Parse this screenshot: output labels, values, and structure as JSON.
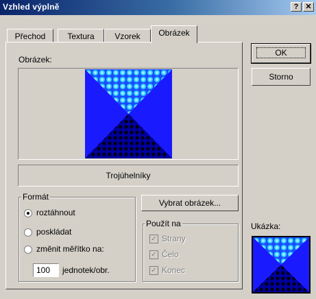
{
  "window": {
    "title": "Vzhled výplně"
  },
  "titlebar": {
    "help_glyph": "?",
    "close_glyph": "✕"
  },
  "tabs": [
    {
      "label": "Přechod"
    },
    {
      "label": "Textura"
    },
    {
      "label": "Vzorek"
    },
    {
      "label": "Obrázek",
      "active": true
    }
  ],
  "picture": {
    "label": "Obrázek:",
    "name": "Trojúhelníky"
  },
  "format": {
    "label": "Formát",
    "options": [
      {
        "label": "roztáhnout",
        "selected": true
      },
      {
        "label": "poskládat",
        "selected": false
      },
      {
        "label": "změnit měřítko na:",
        "selected": false
      }
    ],
    "scale_value": "100",
    "scale_unit": "jednotek/obr."
  },
  "select_picture_button": "Vybrat obrázek...",
  "apply_to": {
    "label": "Použít na",
    "items": [
      {
        "label": "Strany",
        "checked": true
      },
      {
        "label": "Čelo",
        "checked": true
      },
      {
        "label": "Konec",
        "checked": true
      }
    ]
  },
  "buttons": {
    "ok": "OK",
    "cancel": "Storno"
  },
  "preview": {
    "label": "Ukázka:"
  },
  "colors": {
    "blue": "#1a1aff",
    "navy": "#00008b",
    "cyan": "#33ccff"
  }
}
